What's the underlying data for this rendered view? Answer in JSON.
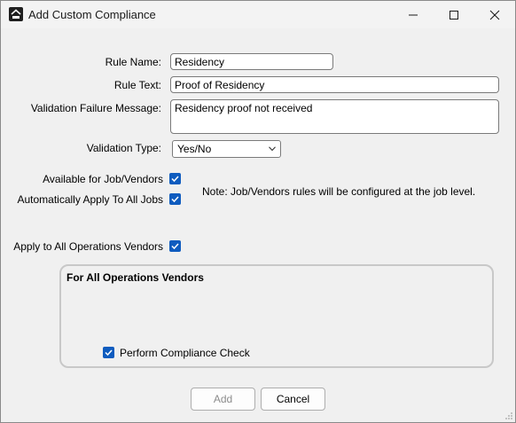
{
  "window": {
    "title": "Add Custom Compliance"
  },
  "form": {
    "rule_name_label": "Rule Name:",
    "rule_name_value": "Residency",
    "rule_text_label": "Rule Text:",
    "rule_text_value": "Proof of Residency",
    "failure_msg_label": "Validation Failure Message:",
    "failure_msg_value": "Residency proof not received",
    "validation_type_label": "Validation Type:",
    "validation_type_value": "Yes/No",
    "available_label": "Available for Job/Vendors",
    "available_checked": true,
    "auto_apply_label": "Automatically Apply To All Jobs",
    "auto_apply_checked": true,
    "note": "Note:  Job/Vendors rules will be configured at the job level.",
    "apply_ops_label": "Apply to All Operations Vendors",
    "apply_ops_checked": true
  },
  "group": {
    "title": "For All Operations Vendors",
    "perform_check_label": "Perform Compliance Check",
    "perform_check_checked": true
  },
  "buttons": {
    "add": "Add",
    "cancel": "Cancel"
  },
  "colors": {
    "checkbox": "#0f5cbf",
    "background": "#f0f0f0"
  }
}
